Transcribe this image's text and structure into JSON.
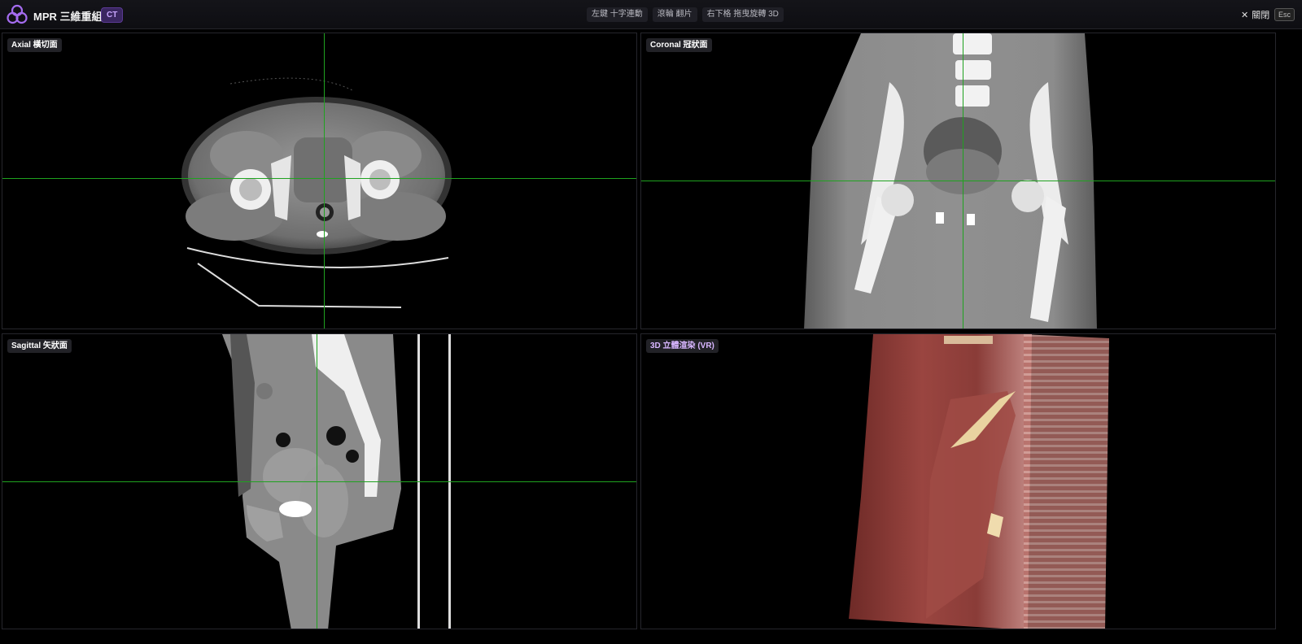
{
  "header": {
    "title": "MPR 三維重組",
    "modality_badge": "CT",
    "hints": [
      "左鍵 十字連動",
      "滾輪 翻片",
      "右下格 拖曳旋轉 3D"
    ],
    "close_label": "關閉",
    "esc_label": "Esc"
  },
  "panes": {
    "axial": {
      "label": "Axial 橫切面"
    },
    "coronal": {
      "label": "Coronal 冠狀面"
    },
    "sagittal": {
      "label": "Sagittal 矢狀面"
    },
    "vr": {
      "label": "3D 立體渲染 (VR)"
    }
  },
  "colors": {
    "crosshair": "#1fa21f",
    "accent": "#8b5cf6",
    "vr_tissue": "#8e3a35"
  },
  "icons": [
    "logo-icon",
    "close-icon"
  ]
}
